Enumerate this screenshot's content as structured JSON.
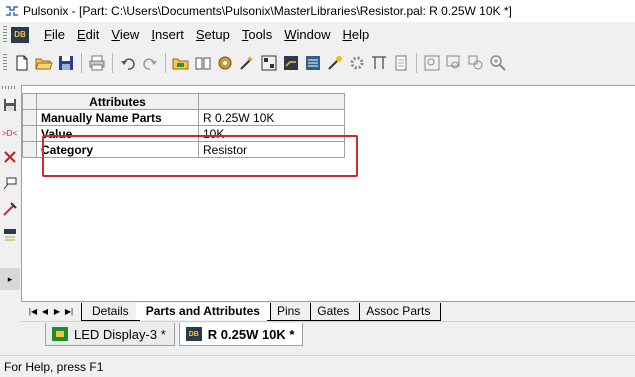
{
  "window": {
    "title": "Pulsonix - [Part: C:\\Users\\Documents\\Pulsonix\\MasterLibraries\\Resistor.pal: R 0.25W 10K *]"
  },
  "menu": {
    "icon_text": "DB",
    "items": [
      {
        "label": "File",
        "u": "F",
        "rest": "ile"
      },
      {
        "label": "Edit",
        "u": "E",
        "rest": "dit"
      },
      {
        "label": "View",
        "u": "V",
        "rest": "iew"
      },
      {
        "label": "Insert",
        "u": "I",
        "rest": "nsert"
      },
      {
        "label": "Setup",
        "u": "S",
        "rest": "etup"
      },
      {
        "label": "Tools",
        "u": "T",
        "rest": "ools"
      },
      {
        "label": "Window",
        "u": "W",
        "rest": "indow"
      },
      {
        "label": "Help",
        "u": "H",
        "rest": "elp"
      }
    ]
  },
  "toolbar": {
    "icons": [
      "new-file-icon",
      "open-folder-icon",
      "save-icon",
      "print-icon",
      "undo-icon",
      "redo-icon",
      "library-icon",
      "book-icon",
      "component-icon",
      "wizard-icon",
      "pattern-icon",
      "pcb-icon",
      "schematic-icon",
      "magic-icon",
      "settings-icon",
      "verify-icon",
      "report-icon",
      "zoom-box-icon",
      "zoom-window-icon",
      "zoom-select-icon",
      "zoom-in-icon"
    ]
  },
  "grid": {
    "header": "Attributes",
    "rows": [
      {
        "label": "Manually Name Parts",
        "value": "R 0.25W 10K"
      },
      {
        "label": "Value",
        "value": "10K"
      },
      {
        "label": "Category",
        "value": "Resistor"
      }
    ]
  },
  "sheet_tabs": {
    "nav": [
      "|◀",
      "◀",
      "▶",
      "▶|"
    ],
    "tabs": [
      "Details",
      "Parts and Attributes",
      "Pins",
      "Gates",
      "Assoc Parts"
    ],
    "active": "Parts and Attributes"
  },
  "document_tabs": [
    {
      "label": "LED Display-3 *",
      "icon_color": "#1e8c2e"
    },
    {
      "label": "R 0.25W 10K *",
      "icon_color": "#2a3a4a",
      "icon_text": "DB"
    }
  ],
  "status": {
    "text": "For Help, press F1"
  },
  "colors": {
    "highlight": "#d02b2b",
    "app_icon": "#2a3a4a"
  }
}
